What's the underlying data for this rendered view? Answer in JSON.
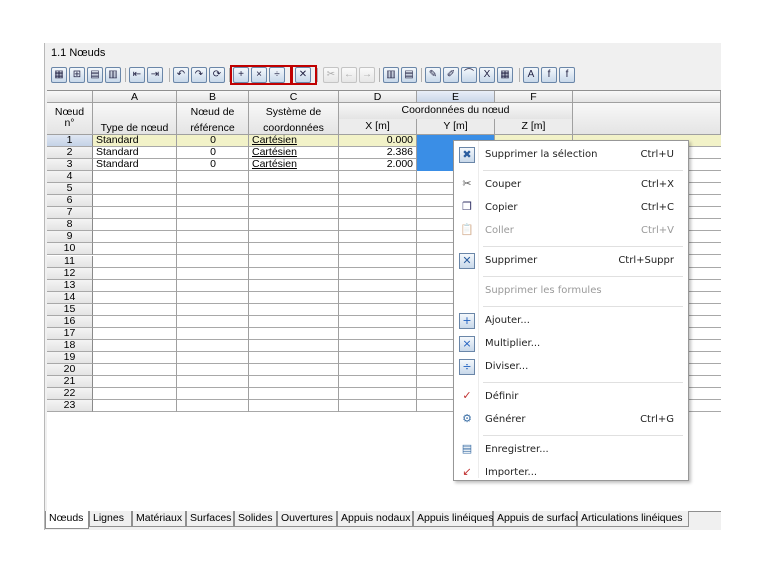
{
  "panel": {
    "title": "1.1 Nœuds"
  },
  "toolbar": {
    "buttons": [
      {
        "name": "select-all-icon"
      },
      {
        "name": "insert-row-icon"
      },
      {
        "name": "table-icon"
      },
      {
        "name": "chart-icon"
      },
      {
        "name": "first-icon"
      },
      {
        "name": "last-icon"
      },
      {
        "name": "undo-icon"
      },
      {
        "name": "redo-icon"
      },
      {
        "name": "refresh-icon"
      },
      {
        "name": "add-icon"
      },
      {
        "name": "multiply-icon"
      },
      {
        "name": "divide-icon"
      },
      {
        "name": "delete-icon"
      },
      {
        "name": "cut-icon"
      },
      {
        "name": "move-left-icon"
      },
      {
        "name": "move-right-icon"
      },
      {
        "name": "columns-icon"
      },
      {
        "name": "rows-icon"
      },
      {
        "name": "define-icon"
      },
      {
        "name": "edit-icon"
      },
      {
        "name": "graph-icon"
      },
      {
        "name": "excel-icon"
      },
      {
        "name": "calculator-icon"
      },
      {
        "name": "text-icon"
      },
      {
        "name": "formula-icon"
      },
      {
        "name": "formula-off-icon"
      }
    ]
  },
  "table": {
    "col_letters": [
      "A",
      "B",
      "C",
      "D",
      "E",
      "F"
    ],
    "row_header_top": "Nœud",
    "row_header_bottom": "n°",
    "headers": {
      "A": "Type de nœud",
      "B_top": "Nœud de",
      "B_bottom": "référence",
      "C_top": "Système de",
      "C_bottom": "coordonnées",
      "group": "Coordonnées du nœud",
      "D": "X [m]",
      "E": "Y [m]",
      "F": "Z [m]"
    },
    "rows": [
      {
        "n": "1",
        "type": "Standard",
        "ref": "0",
        "sys": "Cartésien",
        "x": "0.000"
      },
      {
        "n": "2",
        "type": "Standard",
        "ref": "0",
        "sys": "Cartésien",
        "x": "2.386"
      },
      {
        "n": "3",
        "type": "Standard",
        "ref": "0",
        "sys": "Cartésien",
        "x": "2.000"
      },
      {
        "n": "4"
      },
      {
        "n": "5"
      },
      {
        "n": "6"
      },
      {
        "n": "7"
      },
      {
        "n": "8"
      },
      {
        "n": "9"
      },
      {
        "n": "10"
      },
      {
        "n": "11"
      },
      {
        "n": "12"
      },
      {
        "n": "13"
      },
      {
        "n": "14"
      },
      {
        "n": "15"
      },
      {
        "n": "16"
      },
      {
        "n": "17"
      },
      {
        "n": "18"
      },
      {
        "n": "19"
      },
      {
        "n": "20"
      },
      {
        "n": "21"
      },
      {
        "n": "22"
      },
      {
        "n": "23"
      }
    ]
  },
  "tabs": [
    "Nœuds",
    "Lignes",
    "Matériaux",
    "Surfaces",
    "Solides",
    "Ouvertures",
    "Appuis nodaux",
    "Appuis linéiques",
    "Appuis de surface",
    "Articulations linéiques"
  ],
  "context_menu": [
    {
      "label": "Supprimer la sélection",
      "shortcut": "Ctrl+U",
      "icon": "clear-selection-icon",
      "enabled": true
    },
    {
      "sep": true
    },
    {
      "label": "Couper",
      "shortcut": "Ctrl+X",
      "icon": "scissors-icon",
      "enabled": true
    },
    {
      "label": "Copier",
      "shortcut": "Ctrl+C",
      "icon": "copy-icon",
      "enabled": true
    },
    {
      "label": "Coller",
      "shortcut": "Ctrl+V",
      "icon": "paste-icon",
      "enabled": false
    },
    {
      "sep": true
    },
    {
      "label": "Supprimer",
      "shortcut": "Ctrl+Suppr",
      "icon": "delete-icon",
      "enabled": true
    },
    {
      "sep": true
    },
    {
      "label": "Supprimer les formules",
      "shortcut": "",
      "icon": "",
      "enabled": false
    },
    {
      "sep": true
    },
    {
      "label": "Ajouter...",
      "shortcut": "",
      "icon": "add-icon",
      "enabled": true
    },
    {
      "label": "Multiplier...",
      "shortcut": "",
      "icon": "multiply-icon",
      "enabled": true
    },
    {
      "label": "Diviser...",
      "shortcut": "",
      "icon": "divide-icon",
      "enabled": true
    },
    {
      "sep": true
    },
    {
      "label": "Définir",
      "shortcut": "",
      "icon": "define-icon",
      "enabled": true
    },
    {
      "label": "Générer",
      "shortcut": "Ctrl+G",
      "icon": "generate-icon",
      "enabled": true
    },
    {
      "sep": true
    },
    {
      "label": "Enregistrer...",
      "shortcut": "",
      "icon": "save-icon",
      "enabled": true
    },
    {
      "label": "Importer...",
      "shortcut": "",
      "icon": "import-icon",
      "enabled": true
    }
  ],
  "colors": {
    "selected_row": "#f2f2c8",
    "selected_cell": "#3a8ee6",
    "toolbar_box": "#c00000"
  }
}
